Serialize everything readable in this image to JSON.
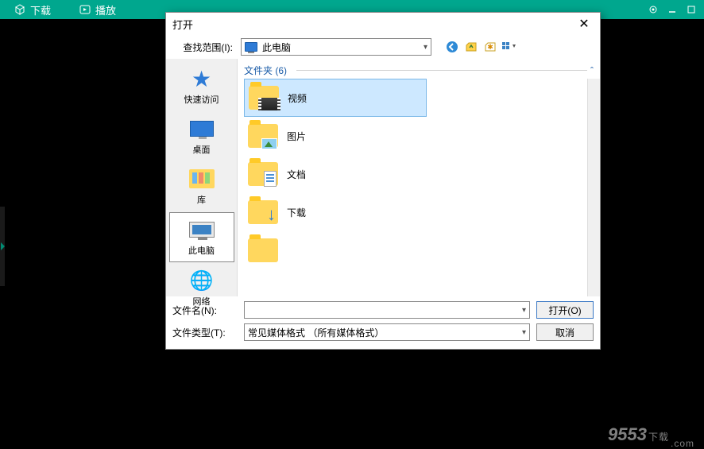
{
  "header": {
    "tabs": [
      {
        "label": "下载",
        "icon": "box-icon"
      },
      {
        "label": "播放",
        "icon": "play-icon"
      }
    ]
  },
  "dialog": {
    "title": "打开",
    "lookin_label": "查找范围(I):",
    "lookin_value": "此电脑",
    "places": [
      {
        "label": "快速访问"
      },
      {
        "label": "桌面"
      },
      {
        "label": "库"
      },
      {
        "label": "此电脑"
      },
      {
        "label": "网络"
      }
    ],
    "group_header": "文件夹 (6)",
    "items": [
      {
        "label": "视频"
      },
      {
        "label": "图片"
      },
      {
        "label": "文档"
      },
      {
        "label": "下载"
      }
    ],
    "filename_label": "文件名(N):",
    "filename_value": "",
    "filetype_label": "文件类型(T):",
    "filetype_value": "常见媒体格式 （所有媒体格式）",
    "open_btn": "打开(O)",
    "cancel_btn": "取消"
  },
  "watermark": {
    "big": "9553",
    "small1": "下载",
    "small2": ".com"
  }
}
